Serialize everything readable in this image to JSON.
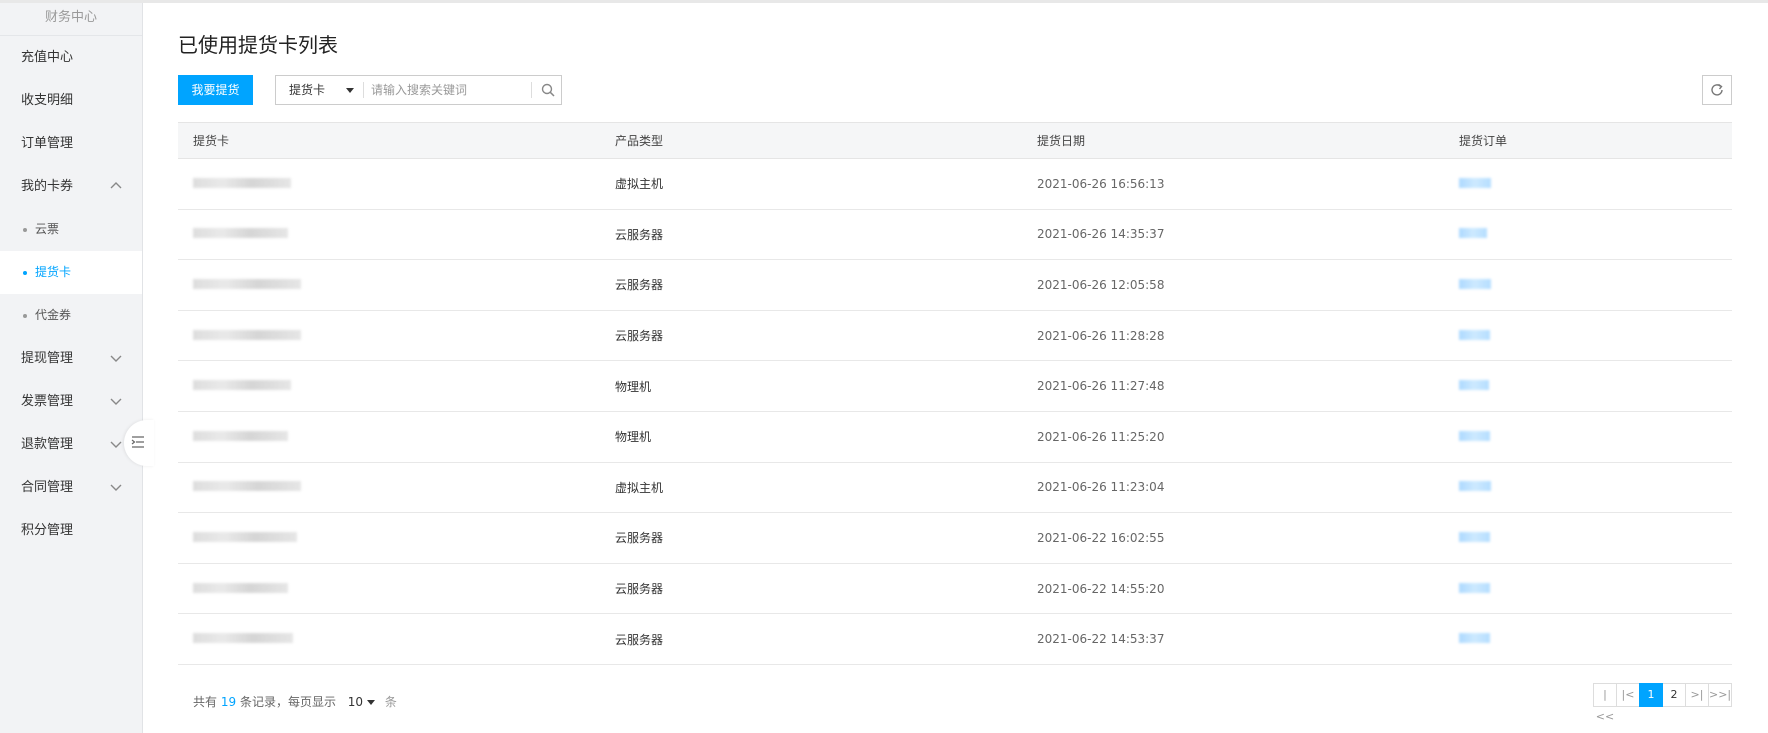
{
  "sidebar": {
    "title": "财务中心",
    "items": [
      {
        "label": "充值中心"
      },
      {
        "label": "收支明细"
      },
      {
        "label": "订单管理"
      },
      {
        "label": "我的卡券"
      },
      {
        "label": "提现管理"
      },
      {
        "label": "发票管理"
      },
      {
        "label": "退款管理"
      },
      {
        "label": "合同管理"
      },
      {
        "label": "积分管理"
      }
    ],
    "sub_items": [
      {
        "label": "云票"
      },
      {
        "label": "提货卡"
      },
      {
        "label": "代金券"
      }
    ],
    "active_sub": "提货卡"
  },
  "page": {
    "title": "已使用提货卡列表",
    "primary_button": "我要提货",
    "search": {
      "select_value": "提货卡",
      "placeholder": "请输入搜索关键词",
      "value": ""
    }
  },
  "table": {
    "columns": [
      "提货卡",
      "产品类型",
      "提货日期",
      "提货订单"
    ],
    "rows": [
      {
        "product": "虚拟主机",
        "date": "2021-06-26 16:56:13"
      },
      {
        "product": "云服务器",
        "date": "2021-06-26 14:35:37"
      },
      {
        "product": "云服务器",
        "date": "2021-06-26 12:05:58"
      },
      {
        "product": "云服务器",
        "date": "2021-06-26 11:28:28"
      },
      {
        "product": "物理机",
        "date": "2021-06-26 11:27:48"
      },
      {
        "product": "物理机",
        "date": "2021-06-26 11:25:20"
      },
      {
        "product": "虚拟主机",
        "date": "2021-06-26 11:23:04"
      },
      {
        "product": "云服务器",
        "date": "2021-06-22 16:02:55"
      },
      {
        "product": "云服务器",
        "date": "2021-06-22 14:55:20"
      },
      {
        "product": "云服务器",
        "date": "2021-06-22 14:53:37"
      }
    ]
  },
  "pagination": {
    "prefix": "共有",
    "total": "19",
    "middle": "条记录，每页显示",
    "page_size": "10",
    "suffix": "条",
    "first": "|<<",
    "prev": "|<",
    "pages": [
      "1",
      "2"
    ],
    "current": "1",
    "next": ">|",
    "last": ">>|"
  },
  "colors": {
    "accent": "#00a4ff",
    "sidebar_bg": "#f2f3f5"
  },
  "icons": {
    "search": "search-icon",
    "refresh": "refresh-icon",
    "collapse": "menu-collapse-icon",
    "chevron_up": "chevron-up-icon",
    "chevron_down": "chevron-down-icon"
  }
}
